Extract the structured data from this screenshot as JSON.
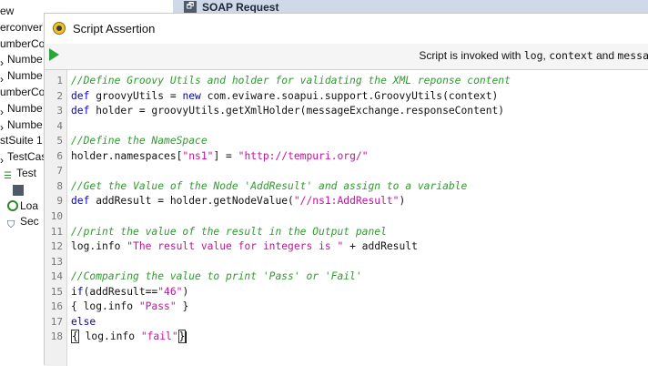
{
  "tree": {
    "rows": [
      {
        "label": "ew",
        "icon": ""
      },
      {
        "label": "erconver",
        "icon": ""
      },
      {
        "label": "umberCo",
        "icon": ""
      },
      {
        "label": "Numbe",
        "icon": "arrow-icon"
      },
      {
        "label": "Numbe",
        "icon": "arrow-icon"
      },
      {
        "label": "umberCo",
        "icon": ""
      },
      {
        "label": "Numbe",
        "icon": "arrow-icon"
      },
      {
        "label": "Numbe",
        "icon": "arrow-icon"
      },
      {
        "label": "stSuite 1",
        "icon": ""
      },
      {
        "label": "TestCas",
        "icon": "arrow-icon"
      },
      {
        "label": "Test",
        "icon": "list-icon"
      },
      {
        "label": "",
        "icon": "soap-step-icon"
      },
      {
        "label": "Loa",
        "icon": "load-icon"
      },
      {
        "label": "Sec",
        "icon": "security-icon"
      }
    ]
  },
  "soap_bar": {
    "title": "SOAP Request",
    "icon_text": "🗗"
  },
  "dialog": {
    "title": "Script Assertion",
    "info_prefix": "Script is invoked with ",
    "info_log": "log",
    "info_sep": ", ",
    "info_ctx": "context",
    "info_and": " and ",
    "info_msg": "messa"
  },
  "editor": {
    "lines": [
      {
        "n": "1",
        "parts": [
          {
            "t": "cm",
            "v": "//Define Groovy Utils and holder for validating the XML reponse content"
          }
        ]
      },
      {
        "n": "2",
        "parts": [
          {
            "t": "kw",
            "v": "def"
          },
          {
            "t": "tx",
            "v": " groovyUtils = "
          },
          {
            "t": "kw",
            "v": "new"
          },
          {
            "t": "tx",
            "v": " com.eviware.soapui.support.GroovyUtils(context)"
          }
        ]
      },
      {
        "n": "3",
        "parts": [
          {
            "t": "kw",
            "v": "def"
          },
          {
            "t": "tx",
            "v": " holder = groovyUtils.getXmlHolder(messageExchange.responseContent)"
          }
        ]
      },
      {
        "n": "4",
        "parts": []
      },
      {
        "n": "5",
        "parts": [
          {
            "t": "cm",
            "v": "//Define the NameSpace"
          }
        ]
      },
      {
        "n": "6",
        "parts": [
          {
            "t": "tx",
            "v": "holder.namespaces["
          },
          {
            "t": "st",
            "v": "\"ns1\""
          },
          {
            "t": "tx",
            "v": "] = "
          },
          {
            "t": "st",
            "v": "\"http://tempuri.org/\""
          }
        ]
      },
      {
        "n": "7",
        "parts": []
      },
      {
        "n": "8",
        "parts": [
          {
            "t": "cm",
            "v": "//Get the Value of the Node 'AddResult' and assign to a variable"
          }
        ]
      },
      {
        "n": "9",
        "parts": [
          {
            "t": "kw",
            "v": "def"
          },
          {
            "t": "tx",
            "v": " addResult = holder.getNodeValue("
          },
          {
            "t": "st",
            "v": "\"//ns1:AddResult\""
          },
          {
            "t": "tx",
            "v": ")"
          }
        ]
      },
      {
        "n": "10",
        "parts": []
      },
      {
        "n": "11",
        "parts": [
          {
            "t": "cm",
            "v": "//print the value of the result in the Output panel"
          }
        ]
      },
      {
        "n": "12",
        "parts": [
          {
            "t": "tx",
            "v": "log.info "
          },
          {
            "t": "st",
            "v": "\"The result value for integers is \""
          },
          {
            "t": "tx",
            "v": " + addResult"
          }
        ]
      },
      {
        "n": "13",
        "parts": []
      },
      {
        "n": "14",
        "parts": [
          {
            "t": "cm",
            "v": "//Comparing the value to print 'Pass' or 'Fail'"
          }
        ]
      },
      {
        "n": "15",
        "parts": [
          {
            "t": "kw",
            "v": "if"
          },
          {
            "t": "tx",
            "v": "(addResult=="
          },
          {
            "t": "st",
            "v": "\"46\""
          },
          {
            "t": "tx",
            "v": ")"
          }
        ]
      },
      {
        "n": "16",
        "parts": [
          {
            "t": "tx",
            "v": "{ log.info "
          },
          {
            "t": "st",
            "v": "\"Pass\""
          },
          {
            "t": "tx",
            "v": " }"
          }
        ]
      },
      {
        "n": "17",
        "parts": [
          {
            "t": "kw",
            "v": "else"
          }
        ]
      },
      {
        "n": "18",
        "parts": [
          {
            "t": "brk",
            "v": "{"
          },
          {
            "t": "tx",
            "v": " log.info "
          },
          {
            "t": "st",
            "v": "\"fail\""
          },
          {
            "t": "brk",
            "v": "}"
          },
          {
            "t": "caret",
            "v": ""
          }
        ]
      }
    ]
  }
}
